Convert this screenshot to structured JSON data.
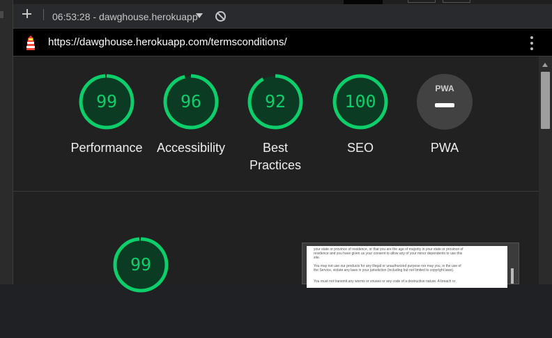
{
  "toolbar": {
    "add_label": "+",
    "report_title": "06:53:28 - dawghouse.herokuapp.com"
  },
  "urlbar": {
    "url": "https://dawghouse.herokuapp.com/termsconditions/"
  },
  "scores": [
    {
      "label": "Performance",
      "value": "99",
      "fraction": 0.99
    },
    {
      "label": "Accessibility",
      "value": "96",
      "fraction": 0.96
    },
    {
      "label": "Best Practices",
      "value": "92",
      "fraction": 0.92
    },
    {
      "label": "SEO",
      "value": "100",
      "fraction": 1.0
    },
    {
      "label": "PWA",
      "badge": "PWA"
    }
  ],
  "performance_detail": {
    "value": "99",
    "fraction": 0.99
  },
  "screenshot_preview": {
    "lines": [
      "your state or province of residence, or that you are the age of majority in your state or province of",
      "residence and you have given us your consent to allow any of your minor dependents to use this",
      "site.",
      "You may not use our products for any illegal or unauthorized purpose nor may you, in the use of",
      "the Service, violate any laws in your jurisdiction (including but not limited to copyright laws).",
      "You must not transmit any worms or viruses or any code of a destructive nature. A breach or"
    ]
  },
  "colors": {
    "pass": "#0cce6b",
    "pass_track": "#0c3b23",
    "background": "#212121"
  }
}
